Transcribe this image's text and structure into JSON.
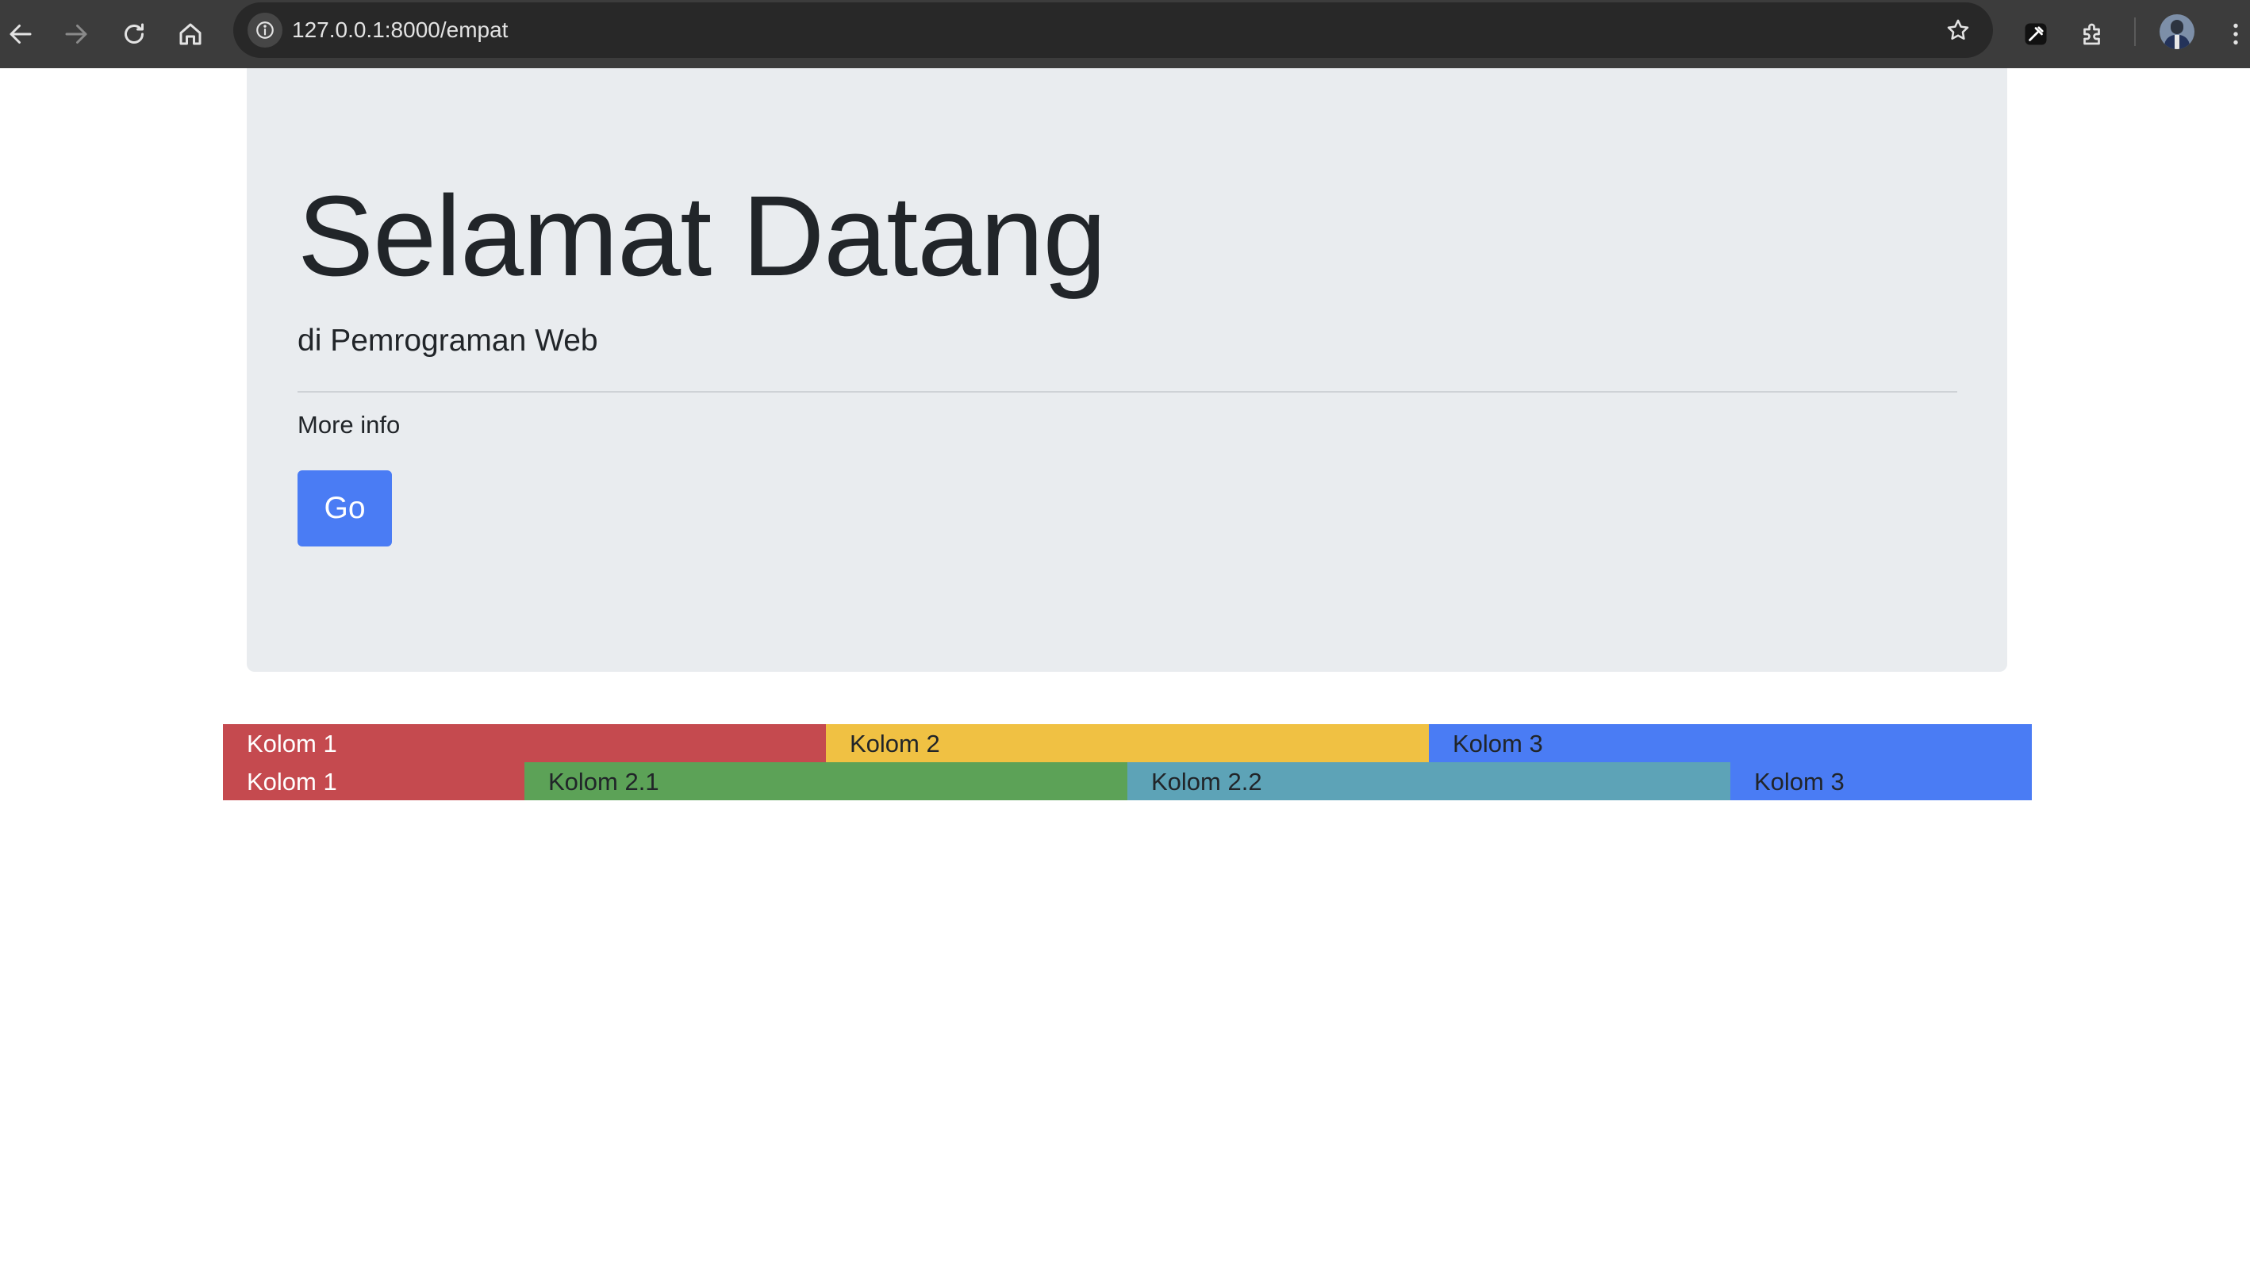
{
  "browser": {
    "url": "127.0.0.1:8000/empat"
  },
  "jumbotron": {
    "title": "Selamat Datang",
    "subtitle": "di Pemrograman Web",
    "more_info": "More info",
    "button_label": "Go"
  },
  "grid": {
    "row1": [
      {
        "label": "Kolom 1",
        "color": "#c54a4f"
      },
      {
        "label": "Kolom 2",
        "color": "#f0c143"
      },
      {
        "label": "Kolom 3",
        "color": "#4a7cf4"
      }
    ],
    "row2": [
      {
        "label": "Kolom 1",
        "color": "#c54a4f"
      },
      {
        "label": "Kolom 2.1",
        "color": "#5ca257"
      },
      {
        "label": "Kolom 2.2",
        "color": "#5da3b7"
      },
      {
        "label": "Kolom 3",
        "color": "#4a7cf4"
      }
    ]
  },
  "colors": {
    "primary": "#4a7cf4",
    "jumbotron_bg": "#e9ecef",
    "toolbar_bg": "#3c3c3c"
  },
  "icons": [
    "back-icon",
    "forward-icon",
    "reload-icon",
    "home-icon",
    "site-info-icon",
    "bookmark-star-icon",
    "eyedropper-icon",
    "extensions-icon",
    "avatar",
    "menu-icon"
  ]
}
